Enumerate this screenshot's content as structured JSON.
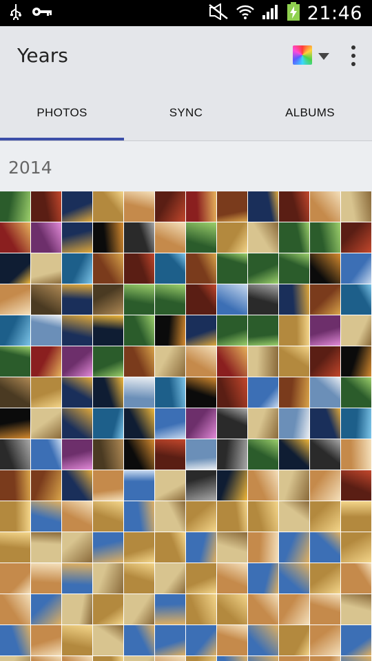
{
  "status_bar": {
    "time": "21:46",
    "icons": [
      "usb-icon",
      "key-icon",
      "mute-icon",
      "wifi-icon",
      "signal-icon",
      "battery-charging-icon"
    ]
  },
  "app_bar": {
    "title": "Years",
    "icons": [
      "color-picker-icon",
      "dropdown-arrow-icon",
      "overflow-menu-icon"
    ]
  },
  "tabs": [
    {
      "label": "PHOTOS",
      "active": true
    },
    {
      "label": "SYNC",
      "active": false
    },
    {
      "label": "ALBUMS",
      "active": false
    }
  ],
  "section": {
    "year": "2014"
  },
  "colors": {
    "tab_indicator": "#3b4ea8",
    "app_bar_bg": "#e4e6ea"
  }
}
